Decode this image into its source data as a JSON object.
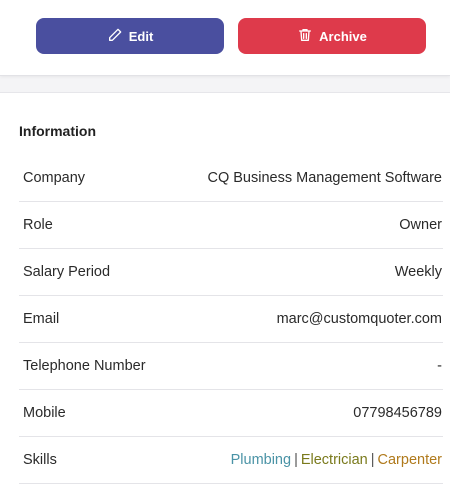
{
  "actions": {
    "edit_label": "Edit",
    "archive_label": "Archive",
    "edit_icon": "pencil-icon",
    "archive_icon": "trash-icon",
    "edit_color": "#4a4f9f",
    "archive_color": "#de3a4b"
  },
  "information": {
    "title": "Information",
    "rows": [
      {
        "label": "Company",
        "value": "CQ Business Management Software"
      },
      {
        "label": "Role",
        "value": "Owner"
      },
      {
        "label": "Salary Period",
        "value": "Weekly"
      },
      {
        "label": "Email",
        "value": "marc@customquoter.com"
      },
      {
        "label": "Telephone Number",
        "value": "-"
      },
      {
        "label": "Mobile",
        "value": "07798456789"
      }
    ],
    "skills": {
      "label": "Skills",
      "separator": "|",
      "items": [
        {
          "name": "Plumbing",
          "color": "#4a93a6"
        },
        {
          "name": "Electrician",
          "color": "#7a7a1c"
        },
        {
          "name": "Carpenter",
          "color": "#b07a1c"
        }
      ]
    }
  }
}
